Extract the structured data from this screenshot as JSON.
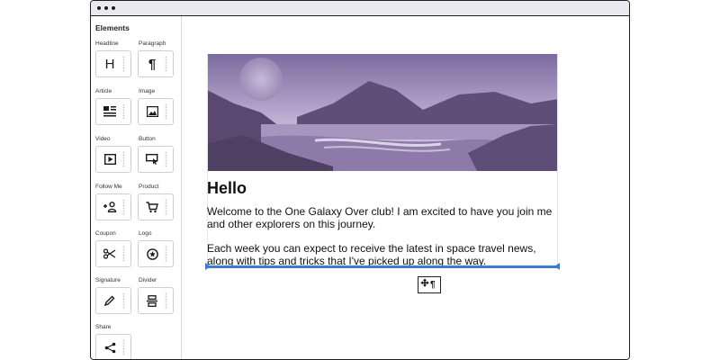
{
  "sidebar": {
    "title": "Elements",
    "items": [
      {
        "label": "Headline",
        "icon": "headline-icon",
        "glyph": "H"
      },
      {
        "label": "Paragraph",
        "icon": "paragraph-icon",
        "glyph": "¶"
      },
      {
        "label": "Article",
        "icon": "article-icon"
      },
      {
        "label": "Image",
        "icon": "image-icon"
      },
      {
        "label": "Video",
        "icon": "video-icon"
      },
      {
        "label": "Button",
        "icon": "button-icon"
      },
      {
        "label": "Follow Me",
        "icon": "follow-me-icon"
      },
      {
        "label": "Product",
        "icon": "product-icon"
      },
      {
        "label": "Coupon",
        "icon": "coupon-icon"
      },
      {
        "label": "Logo",
        "icon": "logo-icon"
      },
      {
        "label": "Signature",
        "icon": "signature-icon"
      },
      {
        "label": "Divider",
        "icon": "divider-icon"
      },
      {
        "label": "Share",
        "icon": "share-icon"
      }
    ]
  },
  "email": {
    "heading": "Hello",
    "paragraph1": "Welcome to the One Galaxy Over club! I am excited to have you join me and other explorers on this journey.",
    "paragraph2": "Each week you can expect to receive the latest in space travel news, along with tips and tricks that I've picked up along the way."
  },
  "drag": {
    "ghost_icon": "paragraph-icon",
    "glyph": "¶"
  },
  "colors": {
    "accent": "#3a7bd5",
    "hero_tint": "#9a86b8"
  }
}
